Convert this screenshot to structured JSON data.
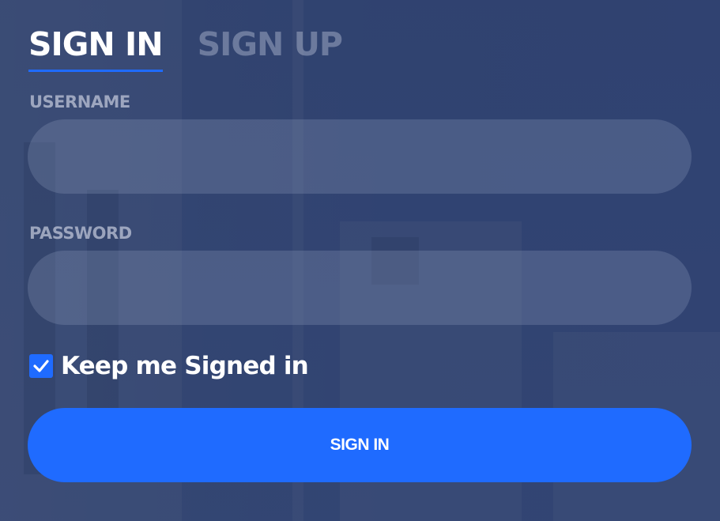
{
  "tabs": {
    "sign_in": "SIGN IN",
    "sign_up": "SIGN UP"
  },
  "form": {
    "username_label": "USERNAME",
    "username_value": "",
    "password_label": "PASSWORD",
    "password_value": "",
    "keep_signed_in_label": "Keep me Signed in",
    "keep_signed_in_checked": true,
    "submit_label": "SIGN IN"
  },
  "colors": {
    "accent": "#1f6bff",
    "background": "#3a4b73",
    "text": "#ffffff"
  },
  "icons": {
    "checkbox": "checkmark-icon"
  }
}
